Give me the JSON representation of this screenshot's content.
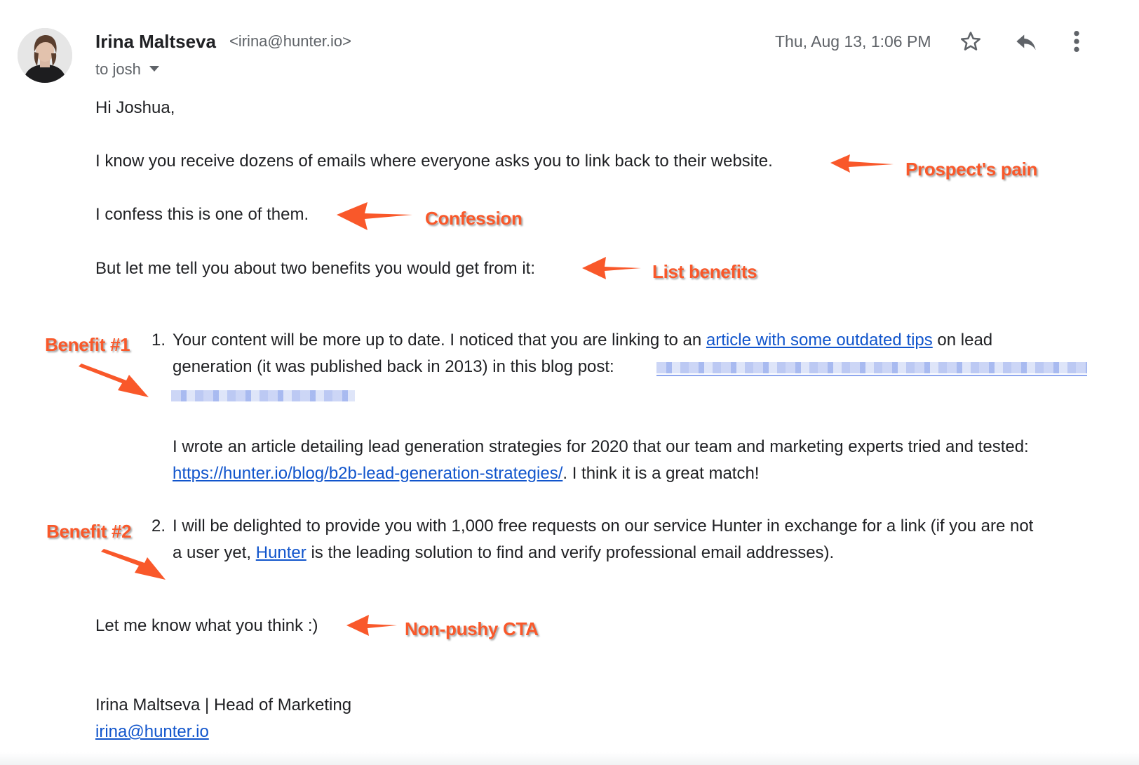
{
  "header": {
    "sender_name": "Irina Maltseva",
    "sender_email": "<irina@hunter.io>",
    "to_line": "to josh",
    "date": "Thu, Aug 13, 1:06 PM",
    "icons": {
      "star": "star-icon",
      "reply": "reply-icon",
      "more": "more-vert-icon",
      "caret": "chevron-down-icon"
    }
  },
  "body": {
    "greeting": "Hi Joshua,",
    "pain_line": "I know you receive dozens of emails where everyone asks you to link back to their website.",
    "confession_line": "I confess this is one of them.",
    "benefits_intro": "But let me tell you about two benefits you would get from it:",
    "item1": {
      "number": "1.",
      "line1_before": "Your content will be more up to date. I noticed that you are linking to an ",
      "line1_link": "article with some outdated tips",
      "line1_after": " on lead",
      "line2": "generation (it was published back in 2013) in this blog post:",
      "para2_line1": "I wrote an article detailing lead generation strategies for 2020 that our team and marketing experts tried and tested:",
      "para2_link": "https://hunter.io/blog/b2b-lead-generation-strategies/",
      "para2_after": ". I think it is a great match!"
    },
    "item2": {
      "number": "2.",
      "line1": "I will be delighted to provide you with 1,000 free requests on our service Hunter in exchange for a link (if you are not",
      "line2_before": "a user yet, ",
      "line2_link": "Hunter",
      "line2_after": " is the leading solution to find and verify professional email addresses)."
    },
    "cta_line": "Let me know what you think :)",
    "signature_name": "Irina Maltseva | Head of Marketing",
    "signature_email": "irina@hunter.io"
  },
  "annotations": {
    "pain": "Prospect's pain",
    "confession": "Confession",
    "list_benefits": "List benefits",
    "benefit1": "Benefit #1",
    "benefit2": "Benefit #2",
    "cta": "Non-pushy CTA"
  },
  "colors": {
    "annotation": "#f9582a",
    "link": "#1155cc",
    "text": "#202124",
    "muted": "#5f6368"
  }
}
